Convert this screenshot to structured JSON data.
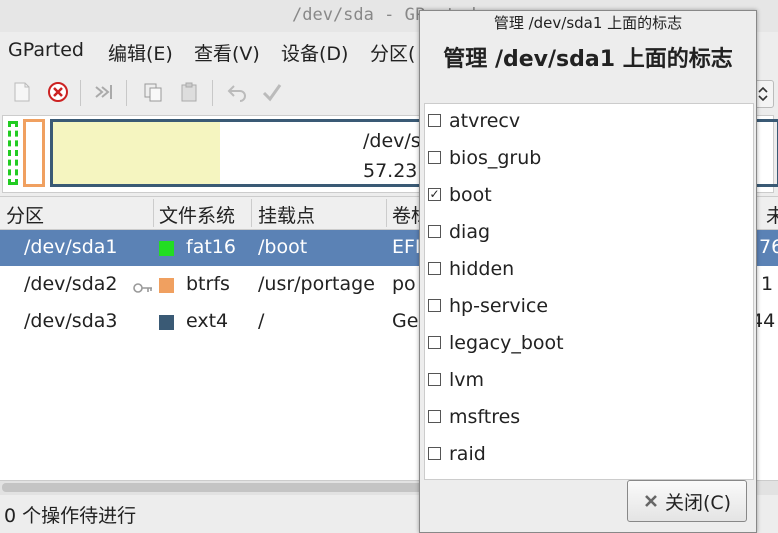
{
  "window": {
    "title": "/dev/sda - GParted"
  },
  "menu": [
    "GParted",
    "编辑(E)",
    "查看(V)",
    "设备(D)",
    "分区("
  ],
  "toolbar": {
    "icons": [
      "new-icon",
      "delete-icon",
      "resize-icon",
      "copy-icon",
      "paste-icon",
      "undo-icon",
      "apply-icon"
    ]
  },
  "diskmap": {
    "label_device": "/dev/s",
    "label_size": "57.23",
    "used_fraction": 0.23
  },
  "table": {
    "headers": [
      "分区",
      "文件系统",
      "挂载点",
      "卷标",
      "未"
    ],
    "rows": [
      {
        "partition": "/dev/sda1",
        "fs": "fat16",
        "mount": "/boot",
        "label": "EFI",
        "extra": "76.",
        "color": "#22dd22",
        "locked": false,
        "selected": true
      },
      {
        "partition": "/dev/sda2",
        "fs": "btrfs",
        "mount": "/usr/portage",
        "label": "po",
        "extra": "1",
        "color": "#f0a060",
        "locked": true,
        "selected": false
      },
      {
        "partition": "/dev/sda3",
        "fs": "ext4",
        "mount": "/",
        "label": "Ge",
        "extra": "44",
        "color": "#3a5a75",
        "locked": false,
        "selected": false
      }
    ]
  },
  "status": {
    "text": "0 个操作待进行"
  },
  "dialog": {
    "title": "管理 /dev/sda1 上面的标志",
    "heading": "管理 /dev/sda1 上面的标志",
    "flags": [
      {
        "name": "atvrecv",
        "checked": false
      },
      {
        "name": "bios_grub",
        "checked": false
      },
      {
        "name": "boot",
        "checked": true
      },
      {
        "name": "diag",
        "checked": false
      },
      {
        "name": "hidden",
        "checked": false
      },
      {
        "name": "hp-service",
        "checked": false
      },
      {
        "name": "legacy_boot",
        "checked": false
      },
      {
        "name": "lvm",
        "checked": false
      },
      {
        "name": "msftres",
        "checked": false
      },
      {
        "name": "raid",
        "checked": false
      }
    ],
    "close_label": "关闭(C)"
  }
}
